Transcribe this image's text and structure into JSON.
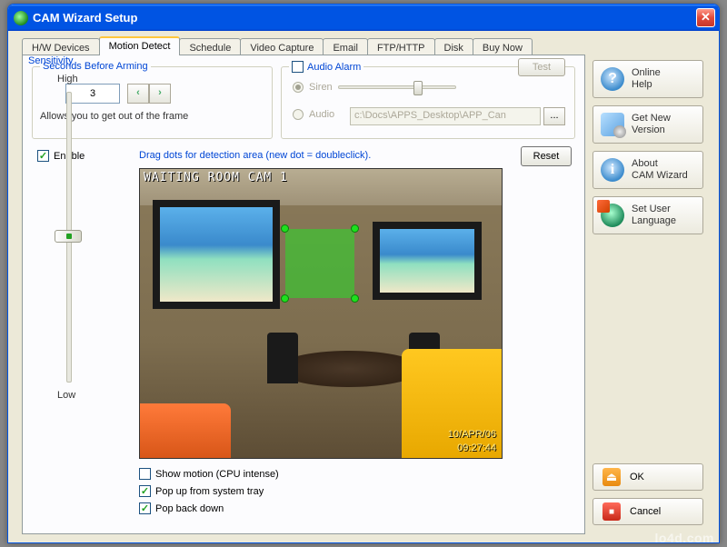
{
  "window": {
    "title": "CAM Wizard Setup"
  },
  "tabs": [
    "H/W Devices",
    "Motion Detect",
    "Schedule",
    "Video Capture",
    "Email",
    "FTP/HTTP",
    "Disk",
    "Buy Now"
  ],
  "active_tab": "Motion Detect",
  "arming": {
    "legend": "Seconds Before Arming",
    "value": "3",
    "hint": "Allows you to get out of the frame"
  },
  "audio": {
    "legend": "Audio Alarm",
    "checked": false,
    "test": "Test",
    "siren_label": "Siren",
    "audio_label": "Audio",
    "path": "c:\\Docs\\APPS_Desktop\\APP_Can",
    "browse": "..."
  },
  "enable": {
    "label": "Enable",
    "checked": true
  },
  "drag_hint": "Drag dots for detection area (new dot = doubleclick).",
  "reset": "Reset",
  "sensitivity": {
    "legend": "Sensitivity",
    "high": "High",
    "low": "Low"
  },
  "preview": {
    "overlay": "WAITING ROOM CAM 1",
    "date": "10/APR/06",
    "time": "09:27:44"
  },
  "checks": {
    "show_motion": {
      "label": "Show motion (CPU intense)",
      "checked": false
    },
    "popup": {
      "label": "Pop up from system tray",
      "checked": true
    },
    "popback": {
      "label": "Pop back down",
      "checked": true
    }
  },
  "side": {
    "help": "Online\nHelp",
    "getnew": "Get New\nVersion",
    "about": "About\nCAM Wizard",
    "lang": "Set User\nLanguage"
  },
  "actions": {
    "ok": "OK",
    "cancel": "Cancel"
  },
  "watermark": "lo4d.com"
}
